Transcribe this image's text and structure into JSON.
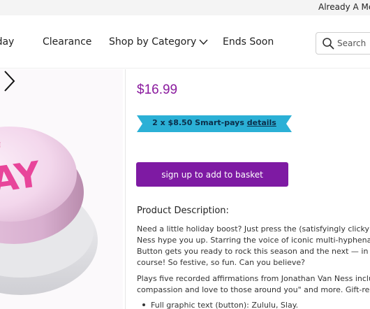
{
  "topbar": {
    "account_link": "Already A Me"
  },
  "nav": {
    "items": [
      "oday",
      "Clearance",
      "Shop by Category",
      "Ends Soon"
    ]
  },
  "search": {
    "placeholder": "Search"
  },
  "gallery": {
    "product_text": "AY"
  },
  "product": {
    "price": "$16.99",
    "smartpays": {
      "text": "2 x $8.50 Smart-pays",
      "link": "details"
    },
    "basket_button": "sign up to add to basket",
    "description_title": "Product Description:",
    "description_lines_1": [
      "Need a little holiday boost? Just press the (satisfyingly clicky) S",
      "Ness hype you up. Starring the voice of iconic multi-hyphenate",
      "Button gets you ready to rock this season and the next — in tha",
      "course! So festive, so fun. Can you believe?"
    ],
    "description_lines_2": [
      "Plays five recorded affirmations from Jonathan Van Ness includi",
      "compassion and love to those around you\" and more. Gift-read"
    ],
    "bullet": "Full graphic text (button): Zululu, Slay."
  },
  "colors": {
    "accent": "#7e1aa3",
    "price": "#8a1a9e",
    "banner": "#2bb0d6"
  }
}
